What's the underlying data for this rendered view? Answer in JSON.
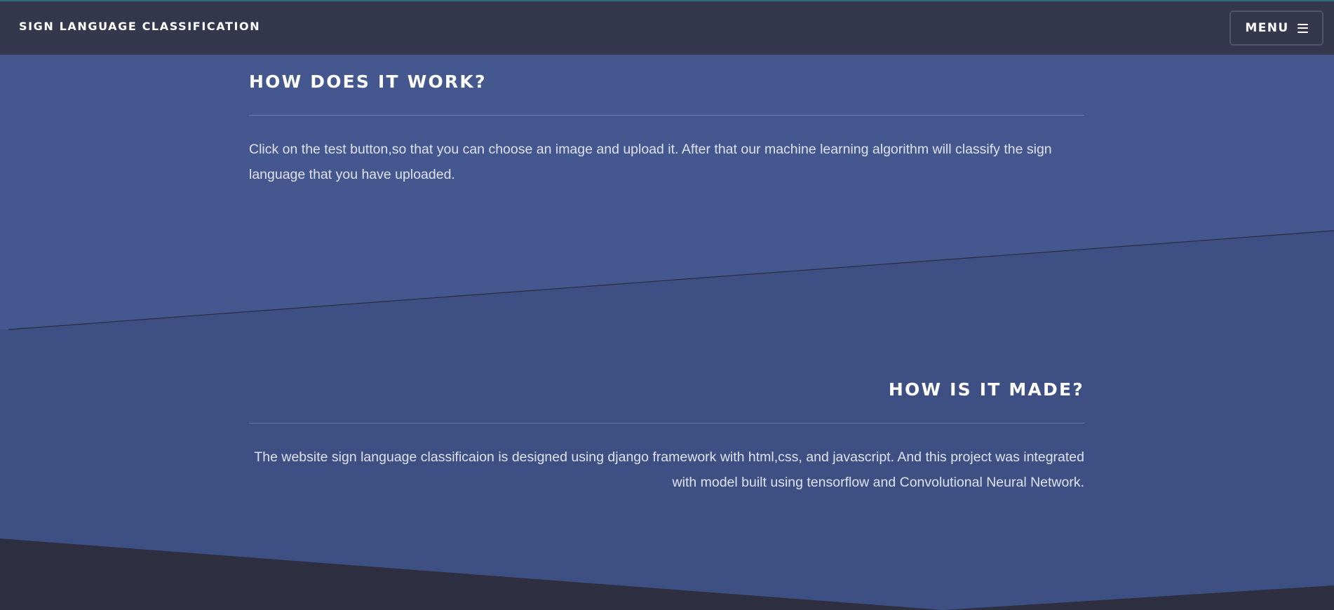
{
  "navbar": {
    "brand": "SIGN LANGUAGE CLASSIFICATION",
    "menu_label": "MENU",
    "menu_icon": "hamburger-icon"
  },
  "sections": [
    {
      "title": "HOW DOES IT WORK?",
      "text": "Click on the test button,so that you can choose an image and upload it. After that our machine learning algorithm will classify the sign language that you have uploaded."
    },
    {
      "title": "HOW IS IT MADE?",
      "text": "The website sign language classificaion is designed using django framework with html,css, and javascript. And this project was integrated with model built using tensorflow and Convolutional Neural Network."
    }
  ],
  "colors": {
    "navbar_bg": "#35384c",
    "section1_bg": "#44578f",
    "section2_bg": "#3e5083",
    "footer_bg": "#2e3042",
    "text_white": "#ffffff",
    "text_body": "#dfe2ef"
  }
}
